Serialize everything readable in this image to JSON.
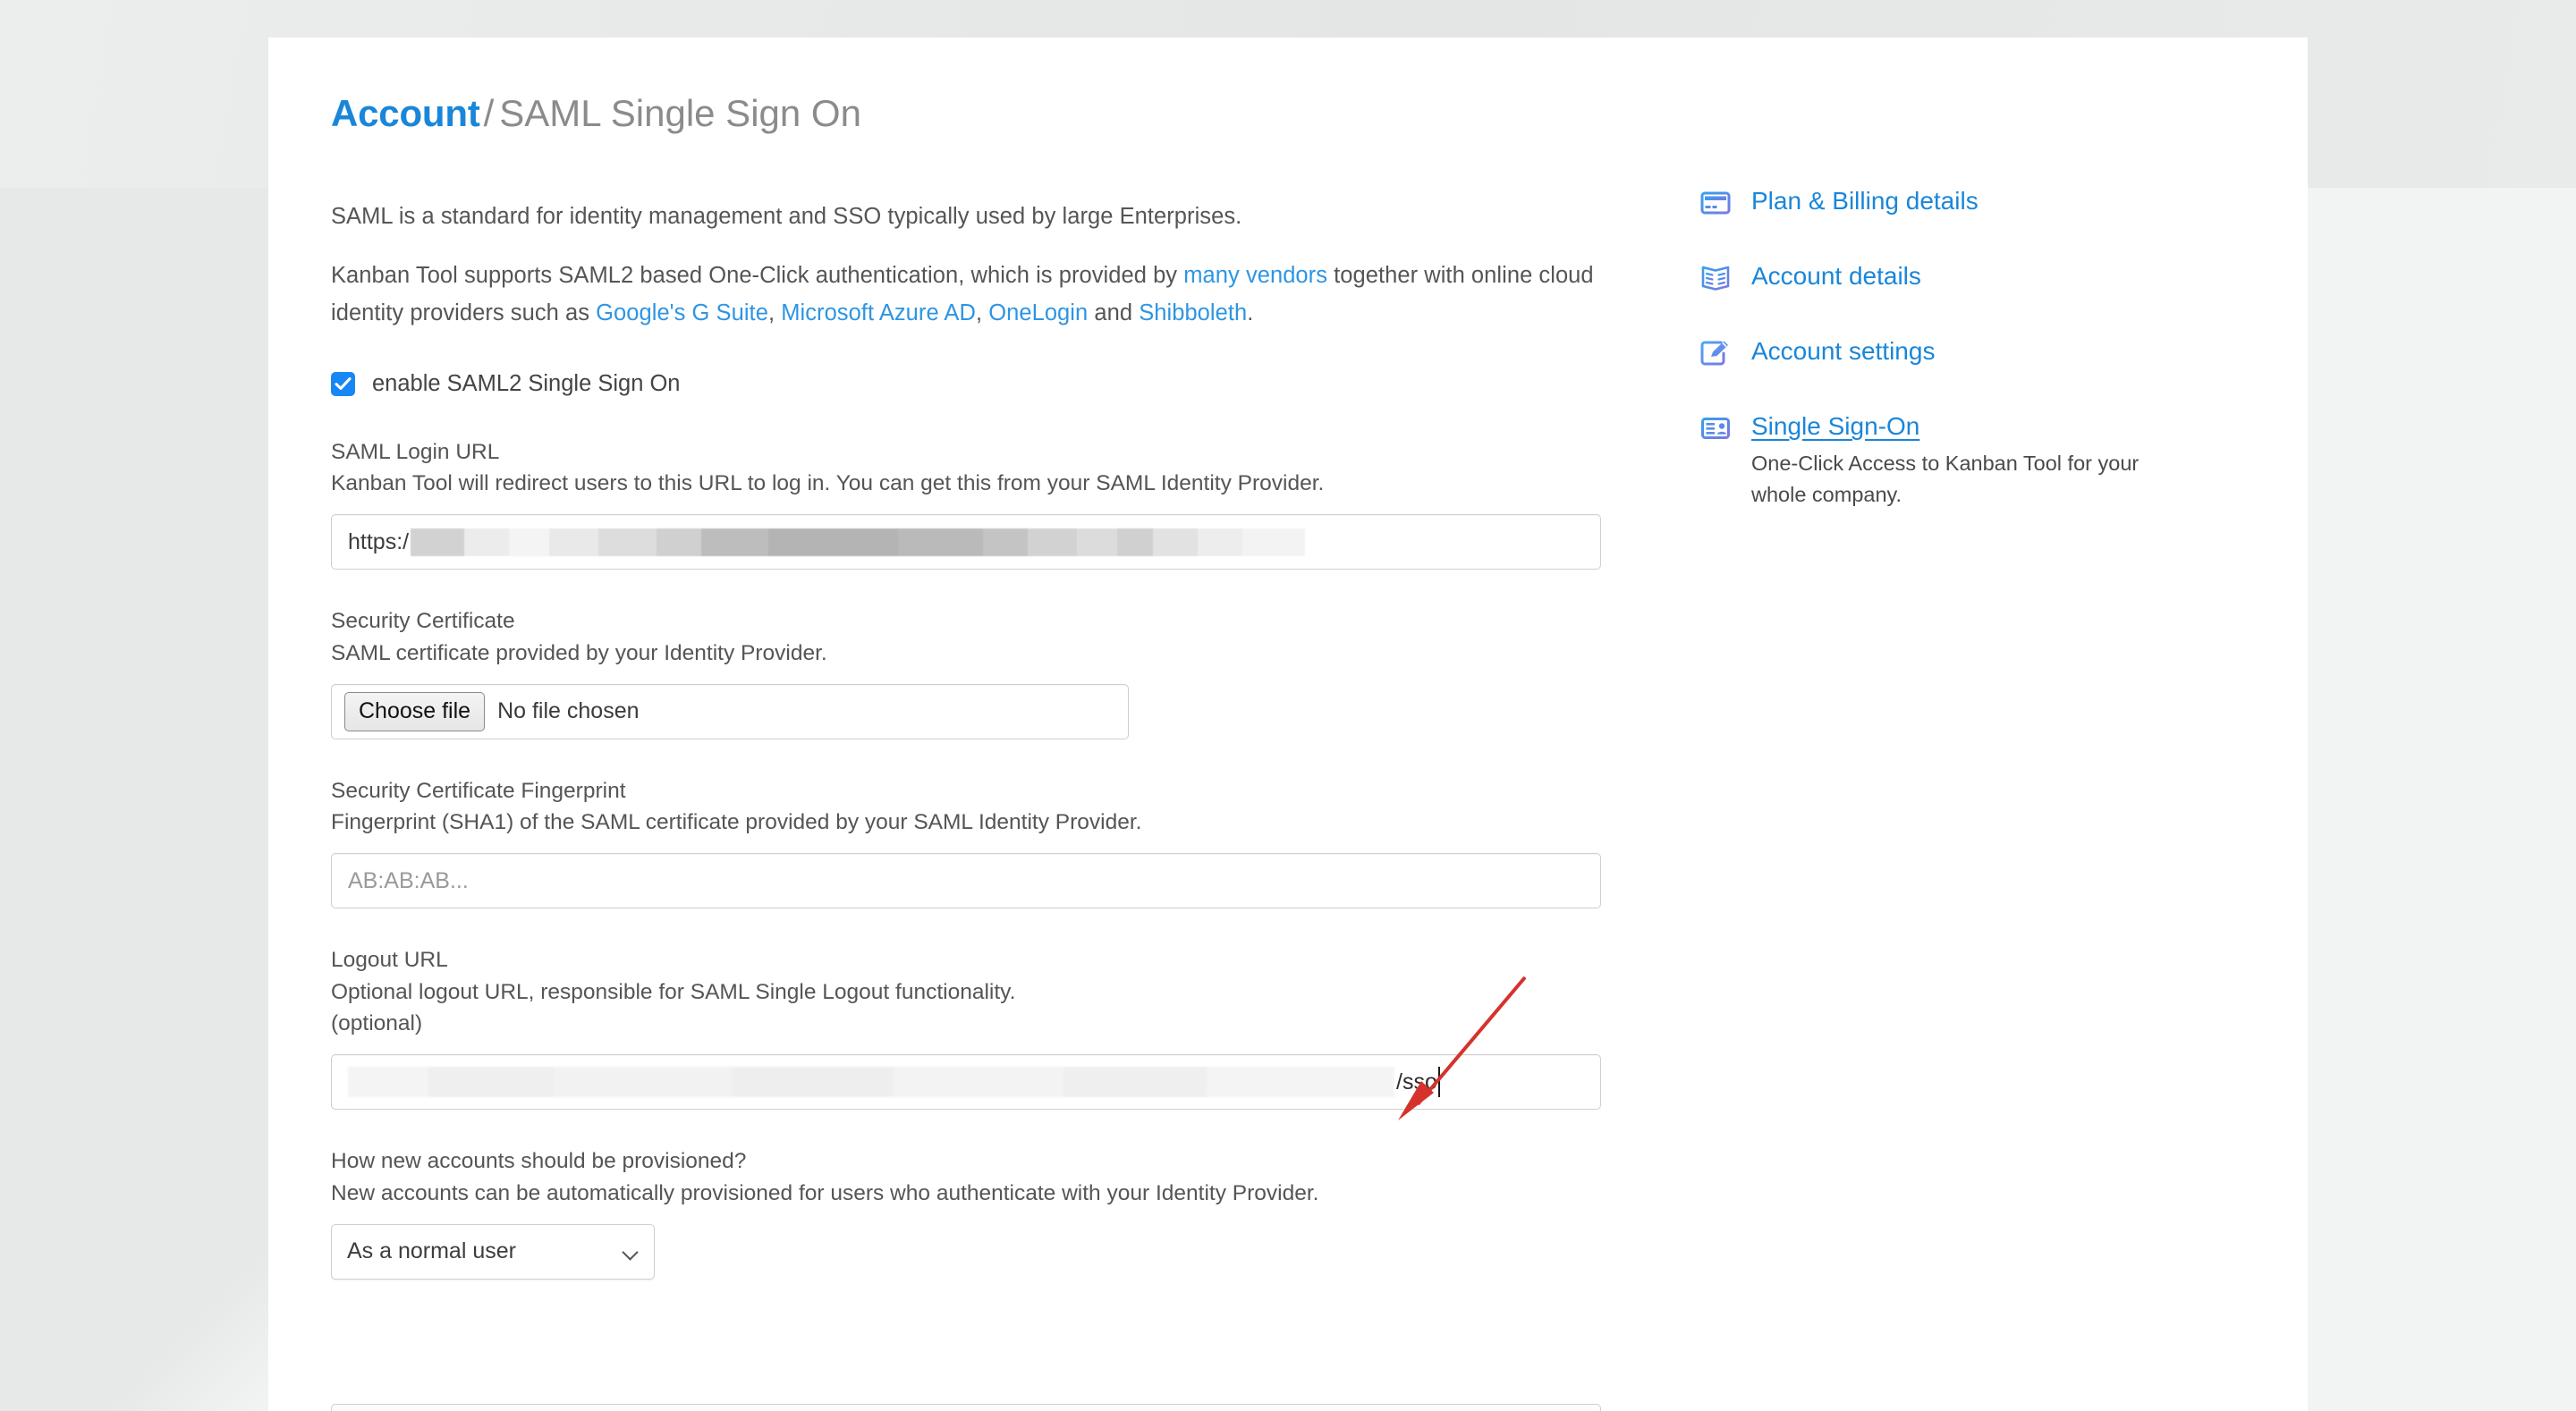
{
  "breadcrumb": {
    "root": "Account",
    "separator": "/",
    "current": "SAML Single Sign On"
  },
  "main": {
    "intro_line1": "SAML is a standard for identity management and SSO typically used by large Enterprises.",
    "intro_line2_part1": "Kanban Tool supports SAML2 based One-Click authentication, which is provided by ",
    "intro_link_vendors": "many vendors",
    "intro_line2_part2": " together with online cloud identity providers such as ",
    "intro_link_gsuite": "Google's G Suite",
    "intro_sep1": ", ",
    "intro_link_azure": "Microsoft Azure AD",
    "intro_sep2": ", ",
    "intro_link_onelogin": "OneLogin",
    "intro_sep3": " and ",
    "intro_link_shibboleth": "Shibboleth",
    "intro_end": ".",
    "enable_checkbox_label": "enable SAML2 Single Sign On",
    "enable_checkbox_checked": true,
    "fields": {
      "login_url": {
        "title": "SAML Login URL",
        "description": "Kanban Tool will redirect users to this URL to log in. You can get this from your SAML Identity Provider.",
        "value_prefix": "https:/",
        "value_redacted": true
      },
      "certificate": {
        "title": "Security Certificate",
        "description": "SAML certificate provided by your Identity Provider.",
        "button_label": "Choose file",
        "status_text": "No file chosen"
      },
      "fingerprint": {
        "title": "Security Certificate Fingerprint",
        "description": "Fingerprint (SHA1) of the SAML certificate provided by your SAML Identity Provider.",
        "placeholder": "AB:AB:AB...",
        "value": ""
      },
      "logout_url": {
        "title": "Logout URL",
        "description": "Optional logout URL, responsible for SAML Single Logout functionality.",
        "optional_note": "(optional)",
        "value_suffix": "/sso",
        "value_redacted": true,
        "focused": true
      },
      "provisioning": {
        "title": "How new accounts should be provisioned?",
        "description": "New accounts can be automatically provisioned for users who authenticate with your Identity Provider.",
        "selected_option": "As a normal user"
      }
    }
  },
  "sidebar": {
    "items": [
      {
        "label": "Plan & Billing details",
        "icon": "credit-card-icon",
        "active": false
      },
      {
        "label": "Account details",
        "icon": "open-book-icon",
        "active": false
      },
      {
        "label": "Account settings",
        "icon": "pencil-square-icon",
        "active": false
      },
      {
        "label": "Single Sign-On",
        "icon": "id-card-icon",
        "active": true
      }
    ],
    "sso_description": "One-Click Access to Kanban Tool for your whole company."
  },
  "annotation": {
    "arrow_color": "#d6322c",
    "points_to": "logout-url-input"
  },
  "colors": {
    "link_blue": "#2d95e3",
    "heading_blue": "#1a86d9",
    "checkbox_blue": "#1787f5",
    "text_gray": "#555555",
    "page_background": "#eef0f0",
    "card_background": "#ffffff"
  }
}
